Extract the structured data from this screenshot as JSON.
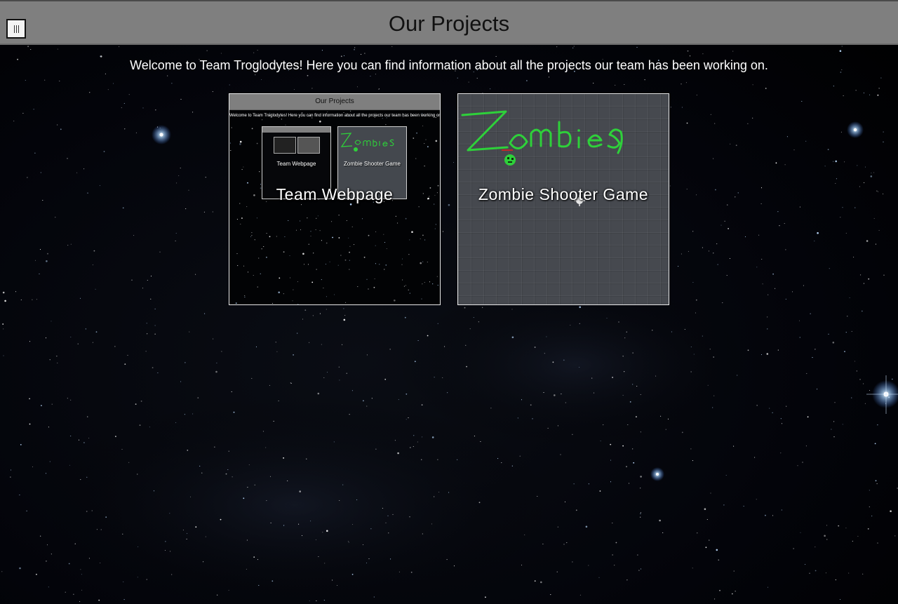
{
  "header": {
    "title": "Our Projects",
    "menu_icon": "hamburger-menu-icon"
  },
  "intro": "Welcome to Team Troglodytes! Here you can find information about all the projects our team has been working on.",
  "projects": [
    {
      "label": "Team Webpage",
      "thumbnail": {
        "title": "Our Projects",
        "intro": "Welcome to Team Troglodytes! Here you can find information about all the projects our team has been working on.",
        "cards": [
          "Team Webpage",
          "Zombie Shooter Game"
        ]
      }
    },
    {
      "label": "Zombie Shooter Game",
      "art_text": "Zombies"
    }
  ],
  "colors": {
    "header_bg": "#7f7f7f",
    "page_bg": "#000000",
    "zombie_green": "#2ed13a",
    "tile_gray": "#46494f"
  }
}
